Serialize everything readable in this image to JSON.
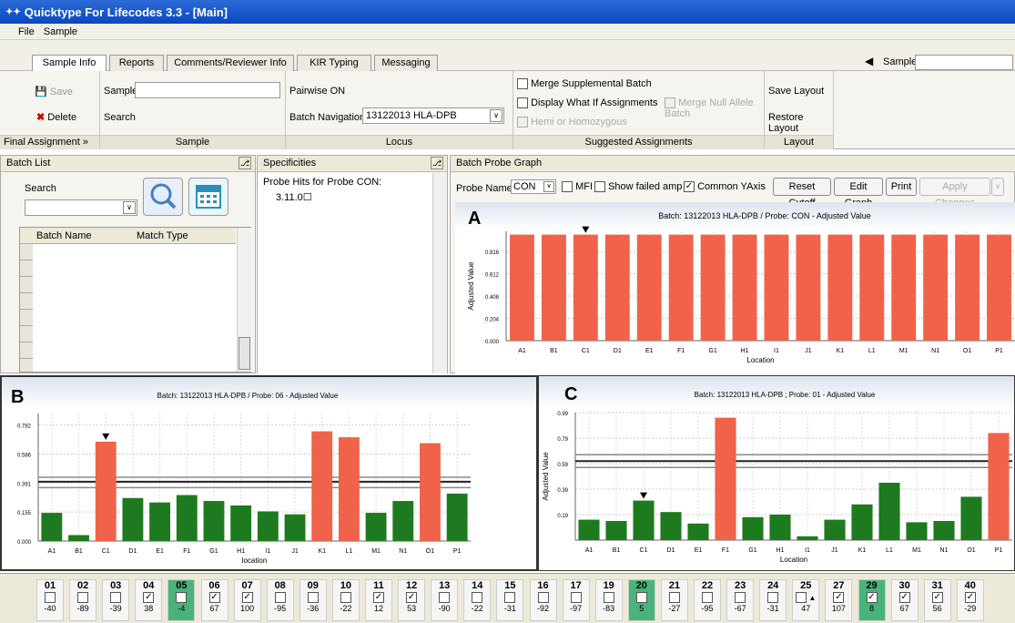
{
  "window": {
    "title": "Quicktype For Lifecodes 3.3 - [Main]"
  },
  "menu": [
    "File",
    "Sample"
  ],
  "tabs": [
    "Sample Info",
    "Reports",
    "Comments/Reviewer Info",
    "KIR Typing",
    "Messaging"
  ],
  "sample_nav": {
    "label": "Sample",
    "value": ""
  },
  "ribbon": {
    "save": "Save",
    "delete": "Delete",
    "final_assignment": "Final Assignment",
    "sample_label": "Sample",
    "search_label": "Search",
    "sample_group": "Sample",
    "pairwise": "Pairwise ON",
    "batch_nav_label": "Batch Navigation",
    "batch_nav_value": "13122013 HLA-DPB",
    "locus_group": "Locus",
    "merge_supp": "Merge Supplemental Batch",
    "display_whatif": "Display What If Assignments",
    "merge_null": "Merge Null Allele Batch",
    "hemi": "Hemi or Homozygous",
    "suggested_group": "Suggested Assignments",
    "save_layout": "Save Layout",
    "restore_layout": "Restore Layout",
    "layout_group": "Layout"
  },
  "batch_list": {
    "title": "Batch List",
    "search_label": "Search",
    "col_name": "Batch Name",
    "col_match": "Match Type"
  },
  "specificities": {
    "title": "Specificities",
    "hits_title": "Probe Hits for Probe CON:",
    "hit": "3.11.0☐"
  },
  "probe_graph": {
    "title": "Batch Probe Graph",
    "probe_name_label": "Probe Name",
    "probe_name": "CON",
    "mfi": "MFI",
    "show_failed": "Show failed amp",
    "common_yaxis": "Common YAxis",
    "reset_cutoff": "Reset Cutoff",
    "edit_graph": "Edit Graph",
    "print": "Print",
    "apply_changes": "Apply Changes"
  },
  "colors": {
    "red": "#f0624a",
    "green": "#1e7a1e"
  },
  "chart_data": [
    {
      "panel": "A",
      "type": "bar",
      "title": "Batch: 13122013 HLA-DPB / Probe: CON - Adjusted Value",
      "xlabel": "Location",
      "ylabel": "Adjusted Value",
      "categories": [
        "A1",
        "B1",
        "C1",
        "D1",
        "E1",
        "F1",
        "G1",
        "H1",
        "I1",
        "J1",
        "K1",
        "L1",
        "M1",
        "N1",
        "O1",
        "P1"
      ],
      "values": [
        0.97,
        0.97,
        0.97,
        0.97,
        0.97,
        0.97,
        0.97,
        0.97,
        0.97,
        0.97,
        0.97,
        0.97,
        0.97,
        0.97,
        0.97,
        0.97
      ],
      "colors": [
        "red",
        "red",
        "red",
        "red",
        "red",
        "red",
        "red",
        "red",
        "red",
        "red",
        "red",
        "red",
        "red",
        "red",
        "red",
        "red"
      ],
      "yticks": [
        "0.000",
        "0.204",
        "0.408",
        "0.612",
        "0.816"
      ],
      "ylim": [
        0,
        1.0
      ],
      "marker_index": 2
    },
    {
      "panel": "B",
      "type": "bar",
      "title": "Batch: 13122013 HLA-DPB / Probe: 06 - Adjusted Value",
      "xlabel": "location",
      "ylabel": "",
      "categories": [
        "A1",
        "B1",
        "C1",
        "D1",
        "E1",
        "F1",
        "G1",
        "H1",
        "I1",
        "J1",
        "K1",
        "L1",
        "M1",
        "N1",
        "O1",
        "P1"
      ],
      "values": [
        0.19,
        0.04,
        0.67,
        0.29,
        0.26,
        0.31,
        0.27,
        0.24,
        0.2,
        0.18,
        0.74,
        0.7,
        0.19,
        0.27,
        0.66,
        0.32
      ],
      "colors": [
        "green",
        "green",
        "red",
        "green",
        "green",
        "green",
        "green",
        "green",
        "green",
        "green",
        "red",
        "red",
        "green",
        "green",
        "red",
        "green"
      ],
      "yticks": [
        "0.000",
        "0.155",
        "0.391",
        "0.586",
        "0.782"
      ],
      "ylim": [
        0,
        0.86
      ],
      "marker_index": 2,
      "cutoffs": [
        0.36,
        0.4,
        0.43
      ]
    },
    {
      "panel": "C",
      "type": "bar",
      "title": "Batch: 13122013 HLA-DPB ; Probe: 01 - Adjusted Value",
      "xlabel": "Location",
      "ylabel": "Adjusted Value",
      "categories": [
        "A1",
        "B1",
        "C1",
        "D1",
        "E1",
        "F1",
        "G1",
        "H1",
        "I1",
        "J1",
        "K1",
        "L1",
        "M1",
        "N1",
        "O1",
        "P1"
      ],
      "values": [
        0.16,
        0.15,
        0.31,
        0.22,
        0.13,
        0.96,
        0.18,
        0.2,
        0.03,
        0.16,
        0.28,
        0.45,
        0.14,
        0.15,
        0.34,
        0.84
      ],
      "colors": [
        "green",
        "green",
        "green",
        "green",
        "green",
        "red",
        "green",
        "green",
        "green",
        "green",
        "green",
        "green",
        "green",
        "green",
        "green",
        "red"
      ],
      "yticks": [
        "",
        "0.19",
        "0.39",
        "0.59",
        "0.79",
        "0.99"
      ],
      "ylim": [
        0,
        1.0
      ],
      "marker_index": 2,
      "cutoffs": [
        0.57,
        0.62,
        0.67
      ]
    }
  ],
  "wells": [
    {
      "num": "01",
      "checked": false,
      "val": "-40",
      "green": false
    },
    {
      "num": "02",
      "checked": false,
      "val": "-89",
      "green": false
    },
    {
      "num": "03",
      "checked": false,
      "val": "-39",
      "green": false
    },
    {
      "num": "04",
      "checked": true,
      "val": "38",
      "green": false
    },
    {
      "num": "05",
      "checked": false,
      "val": "-4",
      "green": true
    },
    {
      "num": "06",
      "checked": true,
      "val": "67",
      "green": false
    },
    {
      "num": "07",
      "checked": true,
      "val": "100",
      "green": false
    },
    {
      "num": "08",
      "checked": false,
      "val": "-95",
      "green": false
    },
    {
      "num": "09",
      "checked": false,
      "val": "-36",
      "green": false
    },
    {
      "num": "10",
      "checked": false,
      "val": "-22",
      "green": false
    },
    {
      "num": "11",
      "checked": true,
      "val": "12",
      "green": false
    },
    {
      "num": "12",
      "checked": true,
      "val": "53",
      "green": false
    },
    {
      "num": "13",
      "checked": false,
      "val": "-90",
      "green": false
    },
    {
      "num": "14",
      "checked": false,
      "val": "-22",
      "green": false
    },
    {
      "num": "15",
      "checked": false,
      "val": "-31",
      "green": false
    },
    {
      "num": "16",
      "checked": false,
      "val": "-92",
      "green": false
    },
    {
      "num": "17",
      "checked": false,
      "val": "-97",
      "green": false
    },
    {
      "num": "19",
      "checked": false,
      "val": "-83",
      "green": false
    },
    {
      "num": "20",
      "checked": false,
      "val": "5",
      "green": true
    },
    {
      "num": "21",
      "checked": false,
      "val": "-27",
      "green": false
    },
    {
      "num": "22",
      "checked": false,
      "val": "-95",
      "green": false
    },
    {
      "num": "23",
      "checked": false,
      "val": "-67",
      "green": false
    },
    {
      "num": "24",
      "checked": false,
      "val": "-31",
      "green": false
    },
    {
      "num": "25",
      "checked": false,
      "val": "47",
      "green": false,
      "marker": true
    },
    {
      "num": "27",
      "checked": true,
      "val": "107",
      "green": false
    },
    {
      "num": "29",
      "checked": true,
      "val": "8",
      "green": true
    },
    {
      "num": "30",
      "checked": true,
      "val": "67",
      "green": false
    },
    {
      "num": "31",
      "checked": true,
      "val": "56",
      "green": false
    },
    {
      "num": "40",
      "checked": true,
      "val": "-29",
      "green": false
    }
  ]
}
